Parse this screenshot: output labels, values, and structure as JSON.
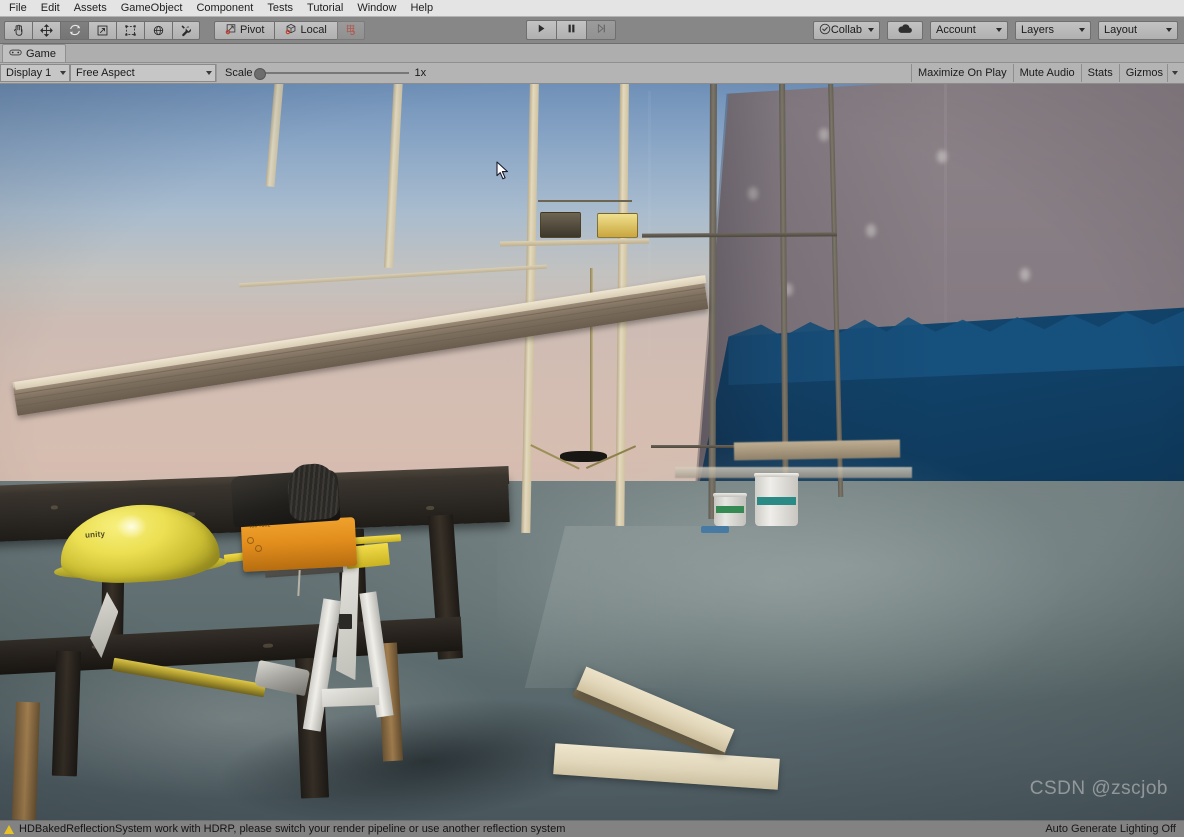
{
  "menubar": {
    "items": [
      {
        "label": "File"
      },
      {
        "label": "Edit"
      },
      {
        "label": "Assets"
      },
      {
        "label": "GameObject"
      },
      {
        "label": "Component"
      },
      {
        "label": "Tests"
      },
      {
        "label": "Tutorial"
      },
      {
        "label": "Window"
      },
      {
        "label": "Help"
      }
    ]
  },
  "toolbar": {
    "tools": [
      {
        "name": "hand-tool",
        "icon": "hand-icon",
        "selected": false
      },
      {
        "name": "move-tool",
        "icon": "move-icon",
        "selected": false
      },
      {
        "name": "rotate-tool",
        "icon": "rotate-icon",
        "selected": true
      },
      {
        "name": "scale-tool",
        "icon": "scale-icon",
        "selected": false
      },
      {
        "name": "rect-tool",
        "icon": "rect-transform-icon",
        "selected": false
      },
      {
        "name": "transform-tool",
        "icon": "transform-icon",
        "selected": false
      },
      {
        "name": "custom-tool",
        "icon": "wrench-icon",
        "selected": false
      }
    ],
    "pivot_label": "Pivot",
    "handle_label": "Local",
    "snap_label": "",
    "play_label": "Play",
    "pause_label": "Pause",
    "step_label": "Step",
    "collab_label": "Collab",
    "cloud_label": "",
    "account_label": "Account",
    "layers_label": "Layers",
    "layout_label": "Layout"
  },
  "panel": {
    "tab_label": "Game",
    "tab_icon": "gamepad-icon",
    "display_label": "Display 1",
    "aspect_label": "Free Aspect",
    "scale_label": "Scale",
    "scale_value": "1x",
    "scale_position_pct": 0,
    "maximize_label": "Maximize On Play",
    "mute_label": "Mute Audio",
    "stats_label": "Stats",
    "gizmos_label": "Gizmos"
  },
  "scene": {
    "hardhat_logo": "unity",
    "saw_label": "RAPTURE",
    "watermark": "CSDN @zscjob",
    "colors": {
      "sky_top": "#6f90b8",
      "sky_haze": "#d6bdb0",
      "wall_paint_blue": "#17517e",
      "wall_drywall": "#8c8389",
      "floor": "#5c6b6d",
      "hardhat_yellow": "#ecdf52",
      "jigsaw_orange": "#e08c1c",
      "wood_light": "#e6dbbe",
      "scaffold_beige": "#ded9bd"
    }
  },
  "statusbar": {
    "warning_icon": "warning-triangle-icon",
    "message": "HDBakedReflectionSystem work with HDRP, please switch your render pipeline or use another reflection system",
    "right_label": "Auto Generate Lighting Off"
  }
}
